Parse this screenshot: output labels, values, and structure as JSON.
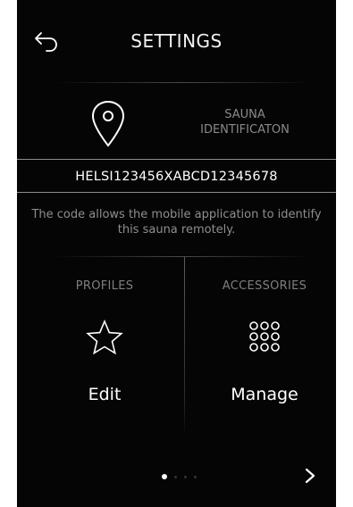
{
  "header": {
    "title": "SETTINGS",
    "back_icon": "back-arrow-icon"
  },
  "sauna_id": {
    "icon": "location-pin-icon",
    "label": "SAUNA\nIDENTIFICATON",
    "code": "HELSI123456XABCD12345678",
    "hint": "The code allows the mobile application to identify this sauna remotely."
  },
  "tiles": [
    {
      "label": "PROFILES",
      "icon": "star-icon",
      "action": "Edit"
    },
    {
      "label": "ACCESSORIES",
      "icon": "grid-dots-icon",
      "action": "Manage"
    }
  ],
  "pagination": {
    "current_page": 1,
    "total_pages": 4,
    "next_icon": "chevron-right-icon"
  },
  "colors": {
    "background": "#050505",
    "text_primary": "#ffffff",
    "text_muted": "#8a8a8a",
    "border": "#8c8c8c"
  }
}
